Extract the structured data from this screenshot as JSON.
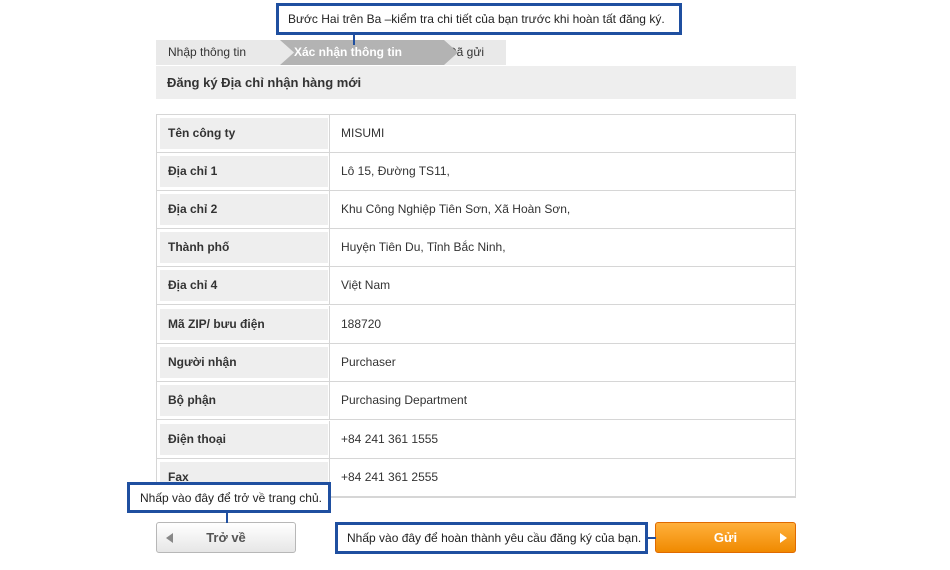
{
  "callouts": {
    "top": "Bước Hai trên Ba –kiểm tra chi tiết của bạn trước khi hoàn tất đăng ký.",
    "back": "Nhấp vào đây để trở về trang chủ.",
    "submit": "Nhấp vào đây để hoàn thành yêu cầu đăng ký của bạn."
  },
  "steps": [
    {
      "label": "Nhập thông tin",
      "active": false
    },
    {
      "label": "Xác nhận thông tin",
      "active": true
    },
    {
      "label": "Đã gửi",
      "active": false
    }
  ],
  "section_title": "Đăng ký Địa chỉ nhận hàng mới",
  "rows": [
    {
      "label": "Tên công ty",
      "value": "MISUMI"
    },
    {
      "label": "Địa chỉ 1",
      "value": "Lô 15, Đường TS11,"
    },
    {
      "label": "Địa chỉ 2",
      "value": "Khu Công Nghiệp Tiên Sơn, Xã Hoàn Sơn,"
    },
    {
      "label": "Thành phố",
      "value": "Huyện Tiên Du, Tỉnh Bắc Ninh,"
    },
    {
      "label": "Địa chỉ 4",
      "value": "Việt Nam"
    },
    {
      "label": "Mã ZIP/ bưu điện",
      "value": "188720"
    },
    {
      "label": "Người nhận",
      "value": "Purchaser"
    },
    {
      "label": "Bộ phận",
      "value": "Purchasing Department"
    },
    {
      "label": "Điện thoại",
      "value": "+84 241 361 1555"
    },
    {
      "label": "Fax",
      "value": "+84 241 361 2555"
    }
  ],
  "buttons": {
    "back": "Trở về",
    "submit": "Gửi"
  },
  "colors": {
    "callout_border": "#1f4fa0",
    "submit_orange": "#f08a00",
    "active_step": "#b3b3b3"
  },
  "icons": {
    "back": "triangle-left-icon",
    "submit": "triangle-right-icon"
  }
}
